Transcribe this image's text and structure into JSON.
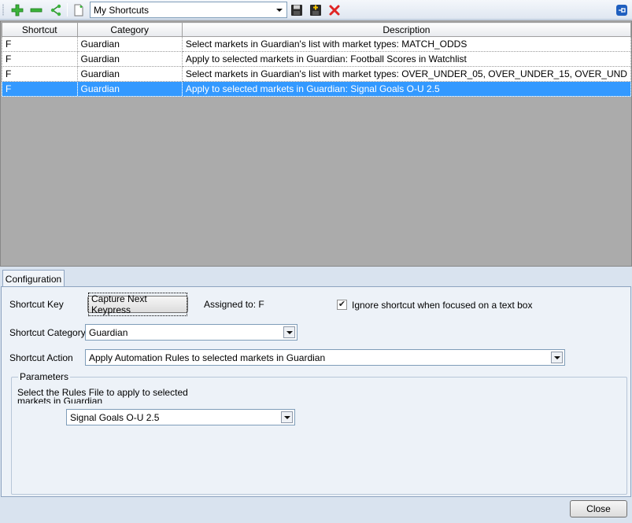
{
  "toolbar": {
    "add_icon": "plus-icon",
    "remove_icon": "minus-icon",
    "share_icon": "share-icon",
    "new_icon": "new-document-icon",
    "shortcut_set": "My Shortcuts",
    "save_icon": "floppy-disk-icon",
    "save_new_icon": "floppy-disk-add-icon",
    "delete_icon": "red-x-icon",
    "pin_icon": "pin-icon"
  },
  "grid": {
    "columns": [
      "Shortcut",
      "Category",
      "Description"
    ],
    "rows": [
      {
        "shortcut": "F",
        "category": "Guardian",
        "description": "Select markets in Guardian's list with market types: MATCH_ODDS"
      },
      {
        "shortcut": "F",
        "category": "Guardian",
        "description": "Apply to selected markets in Guardian: Football Scores in Watchlist"
      },
      {
        "shortcut": "F",
        "category": "Guardian",
        "description": "Select markets in Guardian's list with market types: OVER_UNDER_05, OVER_UNDER_15, OVER_UND"
      },
      {
        "shortcut": "F",
        "category": "Guardian",
        "description": "Apply to selected markets in Guardian: Signal Goals O-U 2.5",
        "selected": true
      }
    ]
  },
  "config": {
    "tab_label": "Configuration",
    "shortcut_key_label": "Shortcut Key",
    "capture_button": "Capture Next Keypress",
    "assigned_to": "Assigned to: F",
    "ignore_label": "Ignore shortcut when focused on a text box",
    "ignore_checked": true,
    "category_label": "Shortcut Category",
    "category_value": "Guardian",
    "action_label": "Shortcut Action",
    "action_value": "Apply Automation Rules to selected markets in Guardian",
    "parameters_legend": "Parameters",
    "parameters_desc": "Select the Rules File to apply to selected markets in Guardian",
    "rules_file_value": "Signal Goals O-U 2.5"
  },
  "footer": {
    "close_button": "Close"
  },
  "colors": {
    "selection": "#3399ff",
    "background": "#d9e3ef"
  }
}
